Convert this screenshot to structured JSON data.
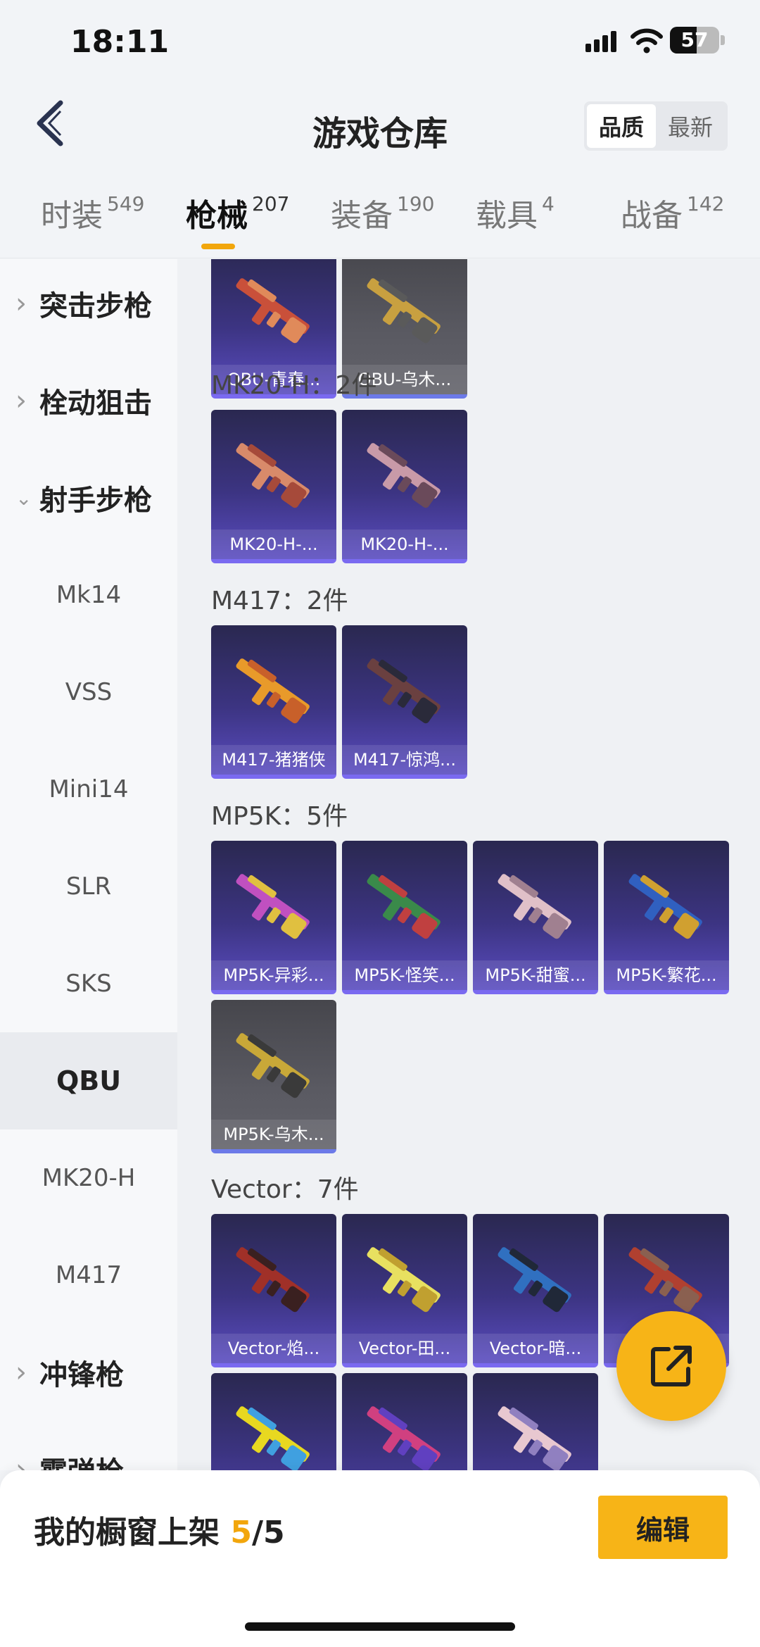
{
  "status_bar": {
    "time": "18:11",
    "battery": "57"
  },
  "header": {
    "title": "游戏仓库",
    "sort_options": [
      "品质",
      "最新"
    ],
    "active_sort": "品质"
  },
  "tabs": [
    {
      "label": "时装",
      "count": "549"
    },
    {
      "label": "枪械",
      "count": "207",
      "active": true
    },
    {
      "label": "装备",
      "count": "190"
    },
    {
      "label": "载具",
      "count": "4"
    },
    {
      "label": "战备",
      "count": "142"
    }
  ],
  "sidebar": {
    "items": [
      {
        "label": "突击步枪",
        "type": "category",
        "expanded": false
      },
      {
        "label": "栓动狙击",
        "type": "category",
        "expanded": false
      },
      {
        "label": "射手步枪",
        "type": "category",
        "expanded": true
      },
      {
        "label": "Mk14",
        "type": "sub"
      },
      {
        "label": "VSS",
        "type": "sub"
      },
      {
        "label": "Mini14",
        "type": "sub"
      },
      {
        "label": "SLR",
        "type": "sub"
      },
      {
        "label": "SKS",
        "type": "sub"
      },
      {
        "label": "QBU",
        "type": "sub",
        "selected": true
      },
      {
        "label": "MK20-H",
        "type": "sub"
      },
      {
        "label": "M417",
        "type": "sub"
      },
      {
        "label": "冲锋枪",
        "type": "category",
        "expanded": false
      },
      {
        "label": "霰弹枪",
        "type": "category",
        "expanded": false
      }
    ]
  },
  "groups": [
    {
      "title": "",
      "items": [
        {
          "label": "QBU-青春...",
          "rarity": "purple"
        },
        {
          "label": "QBU-乌木...",
          "rarity": "gray"
        }
      ]
    },
    {
      "title": "MK20-H：2件",
      "items": [
        {
          "label": "MK20-H-...",
          "rarity": "purple"
        },
        {
          "label": "MK20-H-...",
          "rarity": "purple"
        }
      ]
    },
    {
      "title": "M417：2件",
      "items": [
        {
          "label": "M417-猪猪侠",
          "rarity": "purple"
        },
        {
          "label": "M417-惊鸿...",
          "rarity": "purple"
        }
      ]
    },
    {
      "title": "MP5K：5件",
      "items": [
        {
          "label": "MP5K-异彩...",
          "rarity": "purple"
        },
        {
          "label": "MP5K-怪笑...",
          "rarity": "purple"
        },
        {
          "label": "MP5K-甜蜜...",
          "rarity": "purple"
        },
        {
          "label": "MP5K-繁花...",
          "rarity": "purple"
        },
        {
          "label": "MP5K-乌木...",
          "rarity": "gray"
        }
      ]
    },
    {
      "title": "Vector：7件",
      "items": [
        {
          "label": "Vector-焰...",
          "rarity": "purple"
        },
        {
          "label": "Vector-田...",
          "rarity": "purple"
        },
        {
          "label": "Vector-暗...",
          "rarity": "purple"
        },
        {
          "label": "V",
          "rarity": "purple"
        },
        {
          "label": "",
          "rarity": "purple"
        },
        {
          "label": "",
          "rarity": "purple"
        },
        {
          "label": "",
          "rarity": "purple"
        }
      ]
    }
  ],
  "bottom_bar": {
    "showcase_label": "我的橱窗上架",
    "showcase_count": "5",
    "showcase_total": "/5",
    "edit_label": "编辑"
  },
  "colors": {
    "accent": "#f7b417",
    "tab_underline": "#f2a60c",
    "card_purple": "#3c3482",
    "card_gray": "#5a5a62"
  }
}
